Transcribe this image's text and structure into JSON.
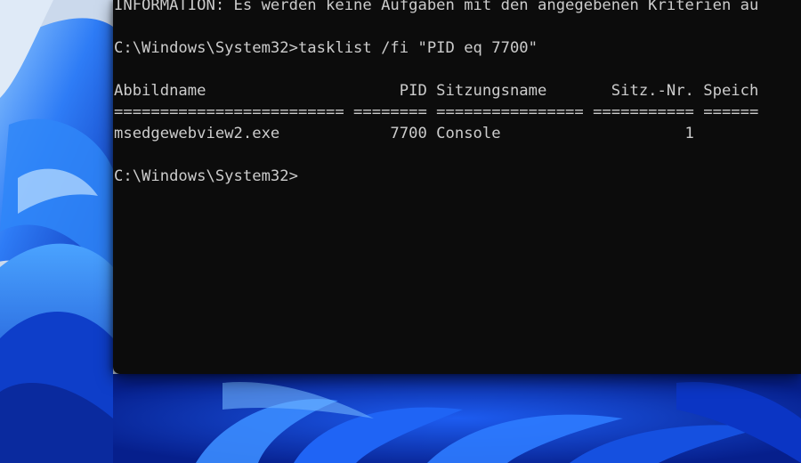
{
  "terminal": {
    "lines": [
      "INFORMATION: Es werden keine Aufgaben mit den angegebenen Kriterien au",
      "",
      "C:\\Windows\\System32>tasklist /fi \"PID eq 7700\"",
      "",
      "Abbildname                     PID Sitzungsname       Sitz.-Nr. Speich",
      "========================= ======== ================ =========== ======",
      "msedgewebview2.exe            7700 Console                    1",
      "",
      "C:\\Windows\\System32>"
    ]
  },
  "colors": {
    "terminal_background": "#0c0c0c",
    "terminal_text": "#cccccc",
    "wallpaper_blue": "#0a2fb8"
  }
}
